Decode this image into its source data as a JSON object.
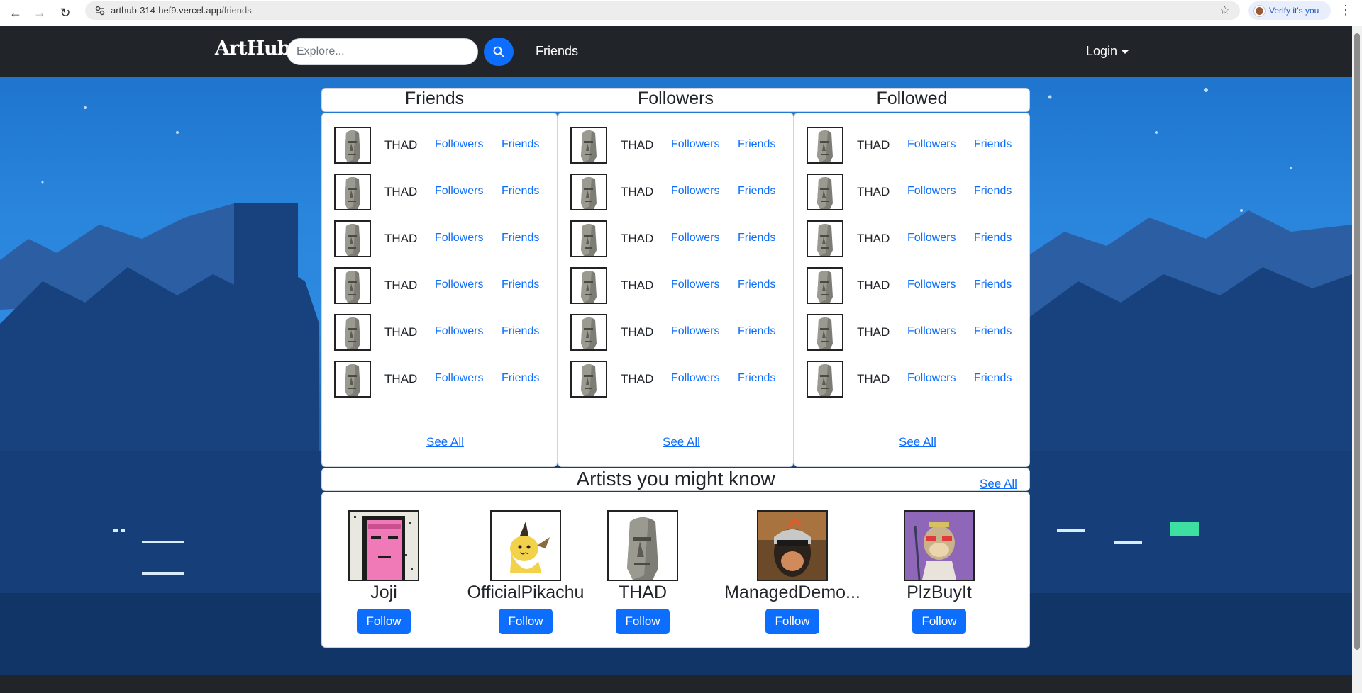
{
  "browser": {
    "url_host": "arthub-314-hef9.vercel.app",
    "url_path": "/friends",
    "verify_label": "Verify it's you"
  },
  "navbar": {
    "brand": "ArtHub",
    "search_placeholder": "Explore...",
    "nav_link": "Friends",
    "login_label": "Login"
  },
  "columns": [
    {
      "title": "Friends",
      "see_all": "See All",
      "rows": [
        {
          "name": "THAD",
          "followers": "Followers",
          "friends": "Friends"
        },
        {
          "name": "THAD",
          "followers": "Followers",
          "friends": "Friends"
        },
        {
          "name": "THAD",
          "followers": "Followers",
          "friends": "Friends"
        },
        {
          "name": "THAD",
          "followers": "Followers",
          "friends": "Friends"
        },
        {
          "name": "THAD",
          "followers": "Followers",
          "friends": "Friends"
        },
        {
          "name": "THAD",
          "followers": "Followers",
          "friends": "Friends"
        }
      ]
    },
    {
      "title": "Followers",
      "see_all": "See All",
      "rows": [
        {
          "name": "THAD",
          "followers": "Followers",
          "friends": "Friends"
        },
        {
          "name": "THAD",
          "followers": "Followers",
          "friends": "Friends"
        },
        {
          "name": "THAD",
          "followers": "Followers",
          "friends": "Friends"
        },
        {
          "name": "THAD",
          "followers": "Followers",
          "friends": "Friends"
        },
        {
          "name": "THAD",
          "followers": "Followers",
          "friends": "Friends"
        },
        {
          "name": "THAD",
          "followers": "Followers",
          "friends": "Friends"
        }
      ]
    },
    {
      "title": "Followed",
      "see_all": "See All",
      "rows": [
        {
          "name": "THAD",
          "followers": "Followers",
          "friends": "Friends"
        },
        {
          "name": "THAD",
          "followers": "Followers",
          "friends": "Friends"
        },
        {
          "name": "THAD",
          "followers": "Followers",
          "friends": "Friends"
        },
        {
          "name": "THAD",
          "followers": "Followers",
          "friends": "Friends"
        },
        {
          "name": "THAD",
          "followers": "Followers",
          "friends": "Friends"
        },
        {
          "name": "THAD",
          "followers": "Followers",
          "friends": "Friends"
        }
      ]
    }
  ],
  "artists": {
    "title": "Artists you might know",
    "see_all": "See All",
    "items": [
      {
        "name": "Joji",
        "follow": "Follow",
        "avatar": "pink-pixel-face"
      },
      {
        "name": "OfficialPikachu",
        "follow": "Follow",
        "avatar": "mimikyu"
      },
      {
        "name": "THAD",
        "follow": "Follow",
        "avatar": "moai"
      },
      {
        "name": "ManagedDemo...",
        "follow": "Follow",
        "avatar": "helmet-portrait"
      },
      {
        "name": "PlzBuyIt",
        "follow": "Follow",
        "avatar": "ape"
      }
    ]
  },
  "colors": {
    "navbar": "#212529",
    "link": "#0d6efd",
    "button": "#0d6efd"
  }
}
